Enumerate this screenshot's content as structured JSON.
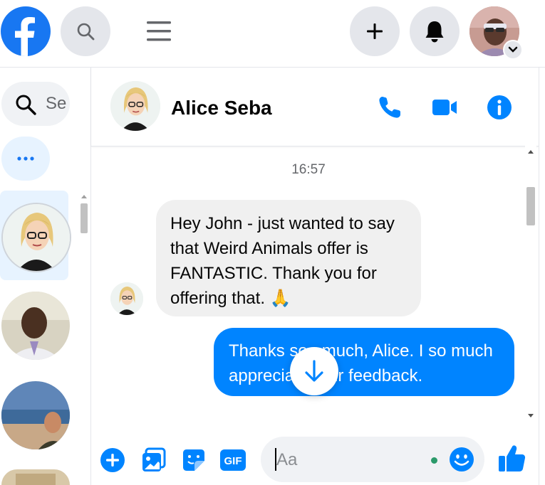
{
  "colors": {
    "brand": "#1877f2",
    "messenger_blue": "#0084ff",
    "incoming_bubble": "#f0f0f0"
  },
  "topbar": {
    "logo_icon": "facebook-logo-icon",
    "search_icon": "search-icon",
    "menu_icon": "hamburger-menu-icon",
    "create_icon": "plus-icon",
    "notifications_icon": "bell-icon",
    "account_menu_icon": "chevron-down-icon"
  },
  "sidebar": {
    "search_text": "Se",
    "more_icon": "more-dots-icon",
    "contacts": [
      {
        "label": "Alice Seba",
        "active": true
      },
      {
        "label": "contact-2",
        "active": false
      },
      {
        "label": "contact-3",
        "active": false
      }
    ]
  },
  "chat": {
    "contact_name": "Alice Seba",
    "header_icons": [
      "phone-icon",
      "video-camera-icon",
      "info-icon"
    ],
    "timestamp": "16:57",
    "messages": [
      {
        "direction": "incoming",
        "text": "Hey John - just wanted to say that Weird Animals offer is FANTASTIC. Thank you for offering that. 🙏"
      },
      {
        "direction": "outgoing",
        "text": "Thanks so much, Alice. I so much appreciate your feedback."
      }
    ],
    "visible_outgoing_line1_left": "Thanks so",
    "visible_outgoing_line1_right": "much, Alice. I so much",
    "visible_outgoing_line2_left": "apprecia",
    "visible_outgoing_line2_right": "ur feedback."
  },
  "composer": {
    "placeholder": "Aa",
    "icons": [
      "plus-circle-icon",
      "gallery-icon",
      "sticker-icon",
      "gif-icon",
      "emoji-icon",
      "thumbs-up-icon"
    ],
    "gif_label": "GIF"
  }
}
